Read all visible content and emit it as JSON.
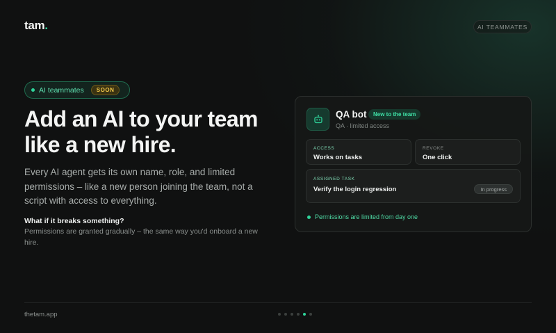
{
  "brand": {
    "name": "tam",
    "dot": "."
  },
  "top_badge": "AI TEAMMATES",
  "hero": {
    "pill_label": "AI teammates",
    "pill_badge": "SOON",
    "headline": "Add an AI to your team like a new hire.",
    "lead": "Every AI agent gets its own name, role, and limited permissions – like a new person joining the team, not a script with access to everything.",
    "faq_question": "What if it breaks something?",
    "faq_answer": "Permissions are granted gradually – the same way you'd onboard a new hire."
  },
  "card": {
    "icon": "robot-icon",
    "name": "QA bot",
    "badge": "New to the team",
    "subtitle": "QA · limited access",
    "access": {
      "label": "ACCESS",
      "value": "Works on tasks"
    },
    "revoke": {
      "label": "REVOKE",
      "value": "One click"
    },
    "task": {
      "label": "ASSIGNED TASK",
      "value": "Verify the login regression",
      "status": "In progress"
    },
    "footnote": "Permissions are limited from day one"
  },
  "footer": {
    "url": "thetam.app",
    "pagination": {
      "total": 6,
      "active": 5
    }
  },
  "colors": {
    "accent": "#2fd49a",
    "soon": "#f0c84a",
    "background": "#101111"
  }
}
